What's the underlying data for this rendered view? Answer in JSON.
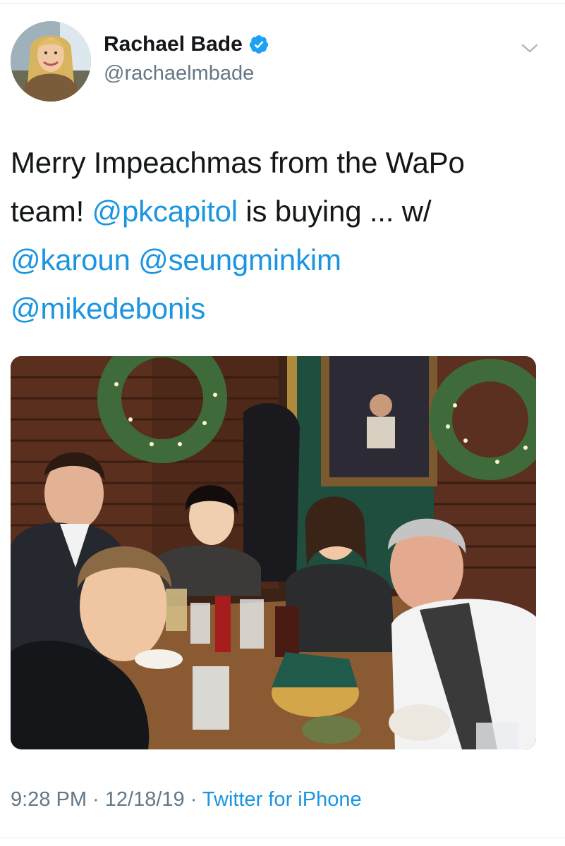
{
  "tweet": {
    "author": {
      "display_name": "Rachael Bade",
      "handle": "@rachaelmbade",
      "verified": true,
      "avatar_icon": "profile-photo"
    },
    "text": {
      "line1": "Merry Impeachmas from the WaPo",
      "line2_prefix": "team! ",
      "mention1": "@pkcapitol",
      "line2_suffix": " is buying ... w/",
      "mention2": "@karoun",
      "mention3": "@seungminkim",
      "mention4": "@mikedebonis"
    },
    "time": "9:28 PM",
    "separator1": " · ",
    "date": "12/18/19",
    "separator2": " · ",
    "source": "Twitter for iPhone"
  },
  "colors": {
    "link": "#1b95e0",
    "secondary_text": "#657786",
    "primary_text": "#14171a",
    "verified_badge": "#1da1f2"
  },
  "icons": {
    "verified": "verified-badge-icon",
    "more": "chevron-down-icon"
  }
}
